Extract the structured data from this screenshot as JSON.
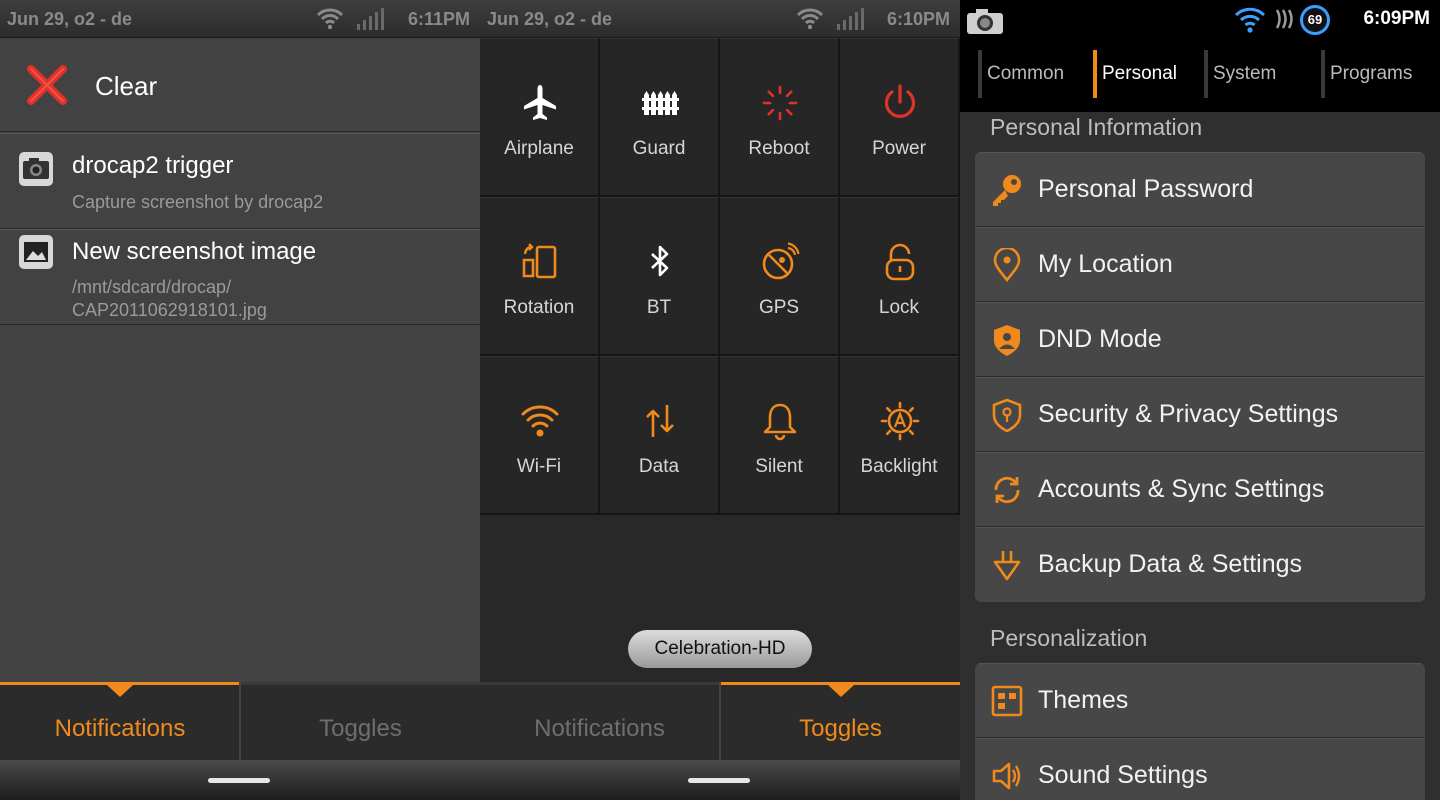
{
  "panel1": {
    "status": {
      "date": "Jun 29,   o2 - de",
      "time": "6:11PM"
    },
    "clear_label": "Clear",
    "notifications": [
      {
        "title": "drocap2 trigger",
        "desc1": "Capture screenshot by drocap2",
        "desc2": ""
      },
      {
        "title": "New screenshot image",
        "desc1": "/mnt/sdcard/drocap/",
        "desc2": "CAP2011062918101.jpg"
      }
    ],
    "tabs": {
      "notifications": "Notifications",
      "toggles": "Toggles"
    }
  },
  "panel2": {
    "status": {
      "date": "Jun 29,   o2 - de",
      "time": "6:10PM"
    },
    "toggles": [
      {
        "label": "Airplane",
        "icon": "airplane-icon"
      },
      {
        "label": "Guard",
        "icon": "fence-icon"
      },
      {
        "label": "Reboot",
        "icon": "reboot-spinner-icon"
      },
      {
        "label": "Power",
        "icon": "power-icon"
      },
      {
        "label": "Rotation",
        "icon": "rotation-icon"
      },
      {
        "label": "BT",
        "icon": "bluetooth-icon"
      },
      {
        "label": "GPS",
        "icon": "gps-satellite-icon"
      },
      {
        "label": "Lock",
        "icon": "unlock-icon"
      },
      {
        "label": "Wi-Fi",
        "icon": "wifi-icon"
      },
      {
        "label": "Data",
        "icon": "data-arrows-icon"
      },
      {
        "label": "Silent",
        "icon": "bell-icon"
      },
      {
        "label": "Backlight",
        "icon": "auto-brightness-icon"
      }
    ],
    "theme_badge": "Celebration-HD",
    "tabs": {
      "notifications": "Notifications",
      "toggles": "Toggles"
    }
  },
  "panel3": {
    "status": {
      "time": "6:09PM",
      "battery": "69"
    },
    "nav": [
      "Common",
      "Personal",
      "System",
      "Programs"
    ],
    "section_personal": "Personal Information",
    "personal_items": [
      {
        "label": "Personal Password",
        "icon": "key-icon"
      },
      {
        "label": "My Location",
        "icon": "location-pin-icon"
      },
      {
        "label": "DND Mode",
        "icon": "dnd-shield-icon"
      },
      {
        "label": "Security & Privacy Settings",
        "icon": "security-shield-icon"
      },
      {
        "label": "Accounts & Sync Settings",
        "icon": "sync-icon"
      },
      {
        "label": "Backup Data & Settings",
        "icon": "backup-icon"
      }
    ],
    "section_personalization": "Personalization",
    "personalization_items": [
      {
        "label": "Themes",
        "icon": "themes-icon"
      },
      {
        "label": "Sound Settings",
        "icon": "speaker-icon"
      }
    ]
  },
  "colors": {
    "accent": "#f08a1c",
    "red": "#e0322a"
  }
}
